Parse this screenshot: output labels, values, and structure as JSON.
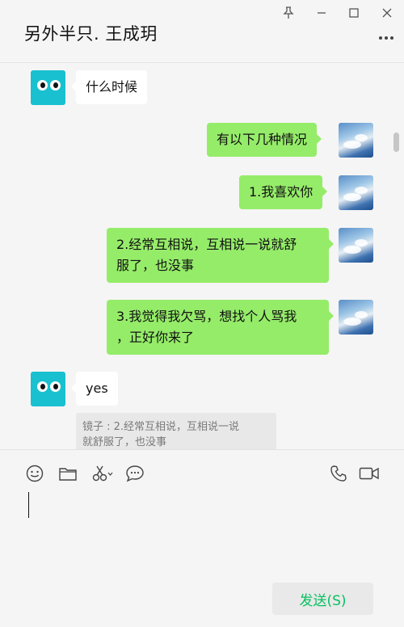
{
  "window": {
    "title": "另外半只. 王成玥",
    "controls": [
      "pin-icon",
      "minimize-icon",
      "maximize-icon",
      "close-icon"
    ],
    "more_icon": "more-icon"
  },
  "messages": [
    {
      "side": "left",
      "text": "什么时候"
    },
    {
      "side": "right",
      "text": "有以下几种情况"
    },
    {
      "side": "right",
      "text": "1.我喜欢你"
    },
    {
      "side": "right",
      "line1": "2.经常互相说，互相说一说就舒",
      "line2": "服了，也没事"
    },
    {
      "side": "right",
      "line1": "3.我觉得我欠骂，想找个人骂我",
      "line2": "，正好你来了"
    },
    {
      "side": "left",
      "text": "yes"
    }
  ],
  "quote": {
    "line1": "镜子 : 2.经常互相说，互相说一说",
    "line2": "就舒服了，也没事"
  },
  "toolbar": {
    "icons": [
      "emoji-icon",
      "folder-icon",
      "scissors-icon",
      "chat-history-icon",
      "phone-icon",
      "video-icon"
    ]
  },
  "send_label": "发送(S)",
  "colors": {
    "my_bubble": "#95ec69",
    "their_bubble": "#ffffff",
    "send_text": "#07c160",
    "avatar_bot": "#19c0d0"
  }
}
